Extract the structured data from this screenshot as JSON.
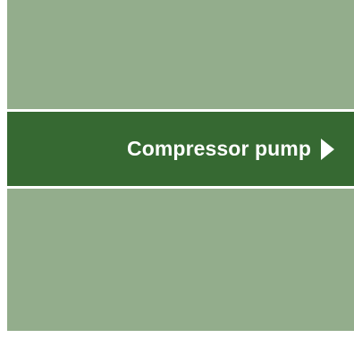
{
  "menu": {
    "active_item": {
      "label": "Compressor pump",
      "icon": "chevron-right-icon"
    },
    "colors": {
      "panel": "#93ad8c",
      "active": "#366932",
      "divider": "#ffffff",
      "text": "#ffffff"
    }
  }
}
